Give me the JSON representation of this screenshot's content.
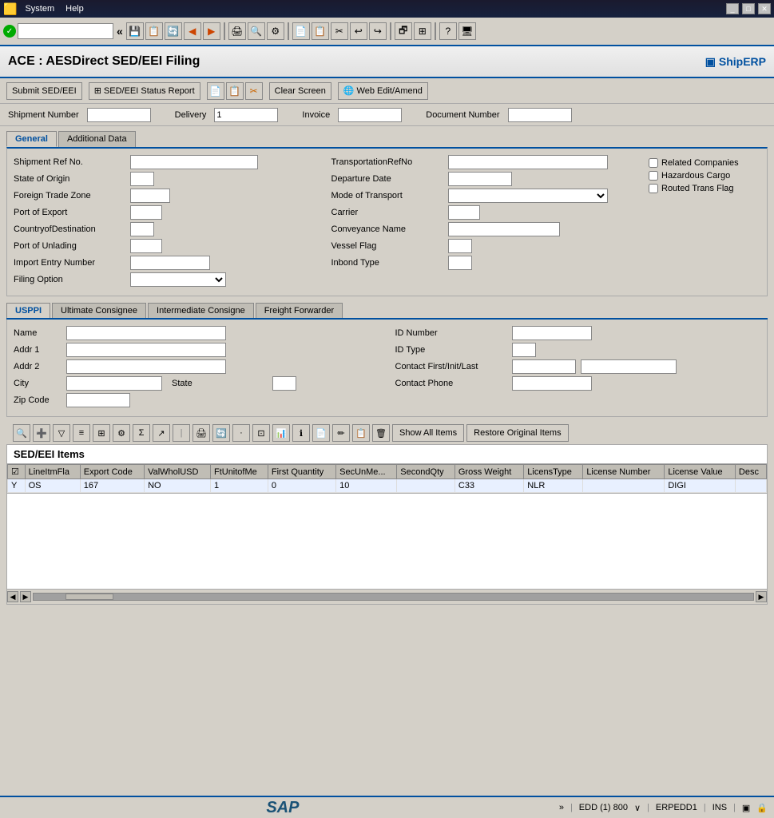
{
  "titleBar": {
    "system": "System",
    "help": "Help",
    "windowTitle": "ACE : AESDirect SED/EEI Filing"
  },
  "toolbar": {
    "navInput": "",
    "navPlaceholder": ""
  },
  "appHeader": {
    "title": "ACE : AESDirect SED/EEI Filing",
    "logo": "▣ ShipERP"
  },
  "actionToolbar": {
    "submitBtn": "Submit SED/EEI",
    "statusBtn": "SED/EEI Status Report",
    "clearBtn": "Clear Screen",
    "webEditBtn": "Web Edit/Amend"
  },
  "topForm": {
    "shipmentNumberLabel": "Shipment Number",
    "shipmentNumber": "",
    "deliveryLabel": "Delivery",
    "delivery": "1",
    "invoiceLabel": "Invoice",
    "invoice": "",
    "documentNumberLabel": "Document Number",
    "documentNumber": ""
  },
  "tabs": {
    "general": "General",
    "additionalData": "Additional Data"
  },
  "generalForm": {
    "leftFields": [
      {
        "label": "Shipment Ref No.",
        "value": "",
        "width": "160"
      },
      {
        "label": "State of Origin",
        "value": "",
        "width": "30"
      },
      {
        "label": "Foreign Trade Zone",
        "value": "",
        "width": "50"
      },
      {
        "label": "Port of Export",
        "value": "",
        "width": "40"
      },
      {
        "label": "CountryofDestination",
        "value": "",
        "width": "30"
      },
      {
        "label": "Port of Unlading",
        "value": "",
        "width": "40"
      },
      {
        "label": "Import Entry Number",
        "value": "",
        "width": "100"
      },
      {
        "label": "Filing Option",
        "value": "",
        "type": "select",
        "width": "120"
      }
    ],
    "rightFields": [
      {
        "label": "TransportationRefNo",
        "value": "",
        "width": "200"
      },
      {
        "label": "Departure Date",
        "value": "",
        "width": "80"
      },
      {
        "label": "Mode of Transport",
        "value": "",
        "type": "select",
        "width": "200"
      },
      {
        "label": "Carrier",
        "value": "",
        "width": "40"
      },
      {
        "label": "Conveyance Name",
        "value": "",
        "width": "140"
      },
      {
        "label": "Vessel Flag",
        "value": "",
        "width": "30"
      },
      {
        "label": "Inbond Type",
        "value": "",
        "width": "30"
      }
    ],
    "checkboxes": [
      {
        "label": "Related Companies",
        "checked": false
      },
      {
        "label": "Hazardous Cargo",
        "checked": false
      },
      {
        "label": "Routed Trans Flag",
        "checked": false
      }
    ]
  },
  "usppiTabs": {
    "tabs": [
      "USPPI",
      "Ultimate Consignee",
      "Intermediate Consigne",
      "Freight Forwarder"
    ],
    "active": "USPPI"
  },
  "usppiForm": {
    "nameLabel": "Name",
    "nameValue": "",
    "addr1Label": "Addr 1",
    "addr1Value": "",
    "addr2Label": "Addr 2",
    "addr2Value": "",
    "cityLabel": "City",
    "cityValue": "",
    "stateLabel": "State",
    "stateValue": "",
    "zipCodeLabel": "Zip Code",
    "zipCodeValue": "",
    "idNumberLabel": "ID Number",
    "idNumberValue": "",
    "idTypeLabel": "ID Type",
    "idTypeValue": "",
    "contactLabel": "Contact First/Init/Last",
    "contactFirst": "",
    "contactLast": "",
    "contactPhoneLabel": "Contact Phone",
    "contactPhoneValue": ""
  },
  "itemsSection": {
    "title": "SED/EEI Items",
    "showAllBtn": "Show All Items",
    "restoreBtn": "Restore Original Items"
  },
  "tableHeaders": [
    "",
    "LineItmFla",
    "Export Code",
    "ValWholUSD",
    "FtUnitofMe",
    "First Quantity",
    "SecUnMe...",
    "SecondQty",
    "Gross Weight",
    "LicensType",
    "License Number",
    "License Value",
    "Desc"
  ],
  "tableRows": [
    {
      "flag": "Y",
      "exportCode": "OS",
      "val": "167",
      "ftUnit": "NO",
      "firstQty": "1",
      "secUnMe": "0",
      "secondQty": "10",
      "gross": "",
      "licType": "C33",
      "licNum": "NLR",
      "licVal": "",
      "desc": "DIGI"
    }
  ],
  "statusBar": {
    "sapLogo": "SAP",
    "session": "EDD (1) 800",
    "server": "ERPEDD1",
    "mode": "INS"
  }
}
